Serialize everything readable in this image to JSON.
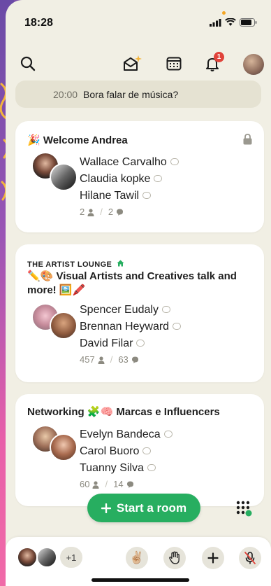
{
  "status": {
    "time": "18:28"
  },
  "notifications": {
    "badge": "1"
  },
  "upcoming": {
    "time": "20:00",
    "title": "Bora falar de música?"
  },
  "rooms": [
    {
      "club": "",
      "title": "🎉 Welcome Andrea",
      "speakers": [
        "Wallace Carvalho",
        "Claudia kopke",
        "Hilane Tawil"
      ],
      "listeners": "2",
      "chats": "2",
      "locked": true
    },
    {
      "club": "THE ARTIST LOUNGE",
      "title": "✏️🎨 Visual Artists and Creatives talk and more! 🖼️🖍️",
      "speakers": [
        "Spencer Eudaly",
        "Brennan Heyward",
        "David Filar"
      ],
      "listeners": "457",
      "chats": "63",
      "locked": false
    },
    {
      "club": "",
      "title": "Networking 🧩🧠 Marcas e Influencers",
      "speakers": [
        "Evelyn Bandeca",
        "Carol Buoro",
        "Tuanny Silva"
      ],
      "listeners": "60",
      "chats": "14",
      "locked": false
    }
  ],
  "start_room": {
    "label": "Start a room"
  },
  "bottom": {
    "extra_count": "+1",
    "wave_emoji": "✌🏼"
  },
  "colors": {
    "accent_green": "#27ae60",
    "badge_red": "#e0433a",
    "background": "#f1efe4"
  }
}
